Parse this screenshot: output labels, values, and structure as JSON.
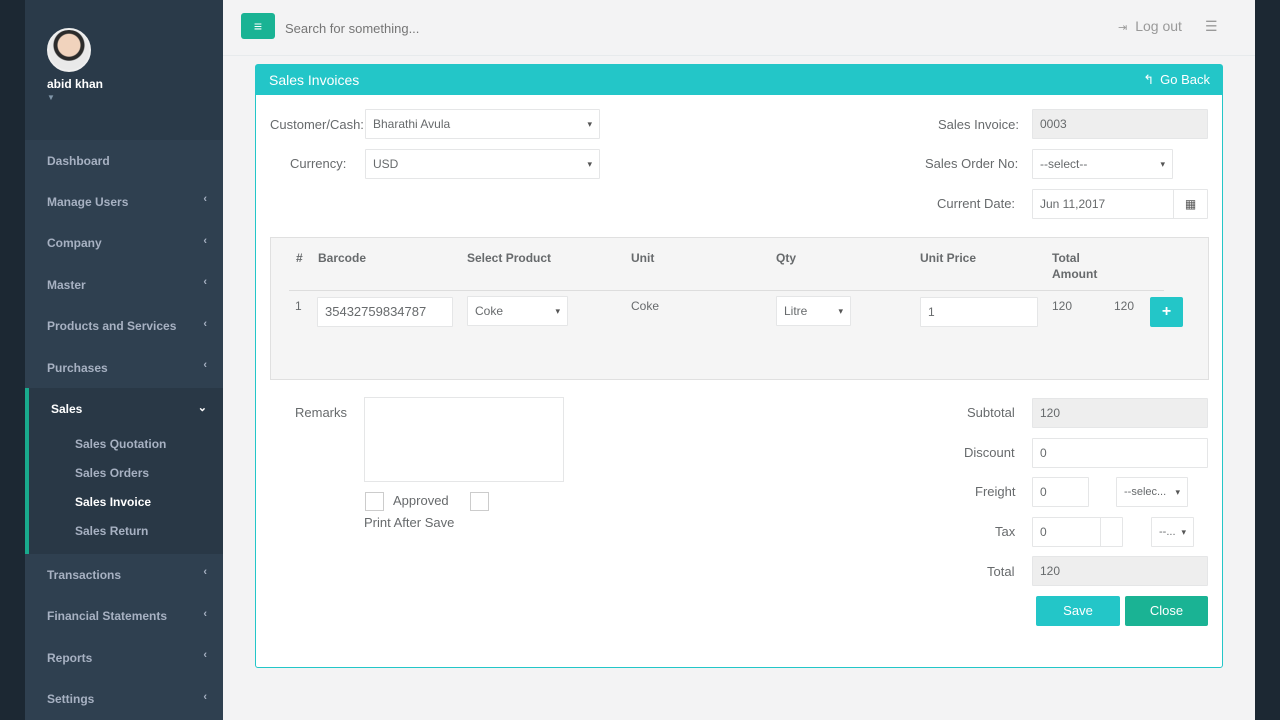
{
  "user": {
    "name": "abid khan"
  },
  "sidebar": {
    "items_top": [
      {
        "label": "Dashboard",
        "chevron": ""
      },
      {
        "label": "Manage Users",
        "chevron": "‹"
      },
      {
        "label": "Company",
        "chevron": "‹"
      },
      {
        "label": "Master",
        "chevron": "‹"
      },
      {
        "label": "Products and Services",
        "chevron": "‹"
      },
      {
        "label": "Purchases",
        "chevron": "‹"
      }
    ],
    "sales": {
      "label": "Sales",
      "chevron": "⌄",
      "children": [
        "Sales Quotation",
        "Sales Orders",
        "Sales Invoice",
        "Sales Return"
      ]
    },
    "items_bottom": [
      {
        "label": "Transactions",
        "chevron": "‹"
      },
      {
        "label": "Financial Statements",
        "chevron": "‹"
      },
      {
        "label": "Reports",
        "chevron": "‹"
      },
      {
        "label": "Settings",
        "chevron": "‹"
      }
    ]
  },
  "topbar": {
    "menu_icon": "≡",
    "search_placeholder": "Search for something...",
    "logout_label": "Log out",
    "logout_icon": "⇥",
    "list_icon": "☰"
  },
  "panel": {
    "title": "Sales Invoices",
    "goback_icon": "↰",
    "goback_label": "Go Back"
  },
  "form": {
    "customer_label": "Customer/Cash:",
    "customer_value": "Bharathi Avula",
    "currency_label": "Currency:",
    "currency_value": "USD",
    "invoice_label": "Sales Invoice:",
    "invoice_value": "0003",
    "order_label": "Sales Order No:",
    "order_value": "--select--",
    "date_label": "Current Date:",
    "date_value": "Jun 11,2017",
    "calendar_icon": "▦"
  },
  "table": {
    "headers": [
      "#",
      "Barcode",
      "Select Product",
      "Unit",
      "Qty",
      "Unit Price",
      "Total",
      "Amount"
    ],
    "row": {
      "num": "1",
      "barcode": "35432759834787",
      "product": "Coke",
      "unit": "Coke",
      "qty_unit": "Litre",
      "qty": "1",
      "unit_price": "120",
      "total_amount": "120",
      "add_icon": "+"
    }
  },
  "remarks": {
    "label": "Remarks",
    "approved_label": "Approved",
    "print_label": "Print After Save"
  },
  "totals": {
    "subtotal_label": "Subtotal",
    "subtotal_value": "120",
    "discount_label": "Discount",
    "discount_value": "0",
    "freight_label": "Freight",
    "freight_value": "0",
    "freight_select": "--selec...",
    "tax_label": "Tax",
    "tax_value": "0",
    "tax_select": "--...",
    "total_label": "Total",
    "total_value": "120"
  },
  "buttons": {
    "save": "Save",
    "close": "Close"
  }
}
